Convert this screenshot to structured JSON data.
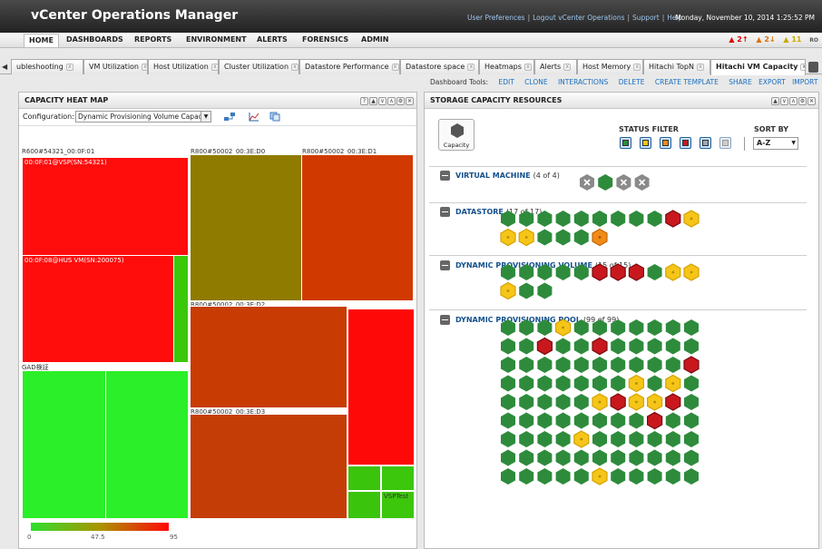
{
  "header": {
    "title": "vCenter Operations Manager",
    "links": [
      "User Preferences",
      "Logout vCenter Operations",
      "Support",
      "Help"
    ],
    "datetime": "Monday, November 10, 2014 1:25:52 PM"
  },
  "nav": {
    "items": [
      "HOME",
      "DASHBOARDS",
      "REPORTS",
      "ENVIRONMENT",
      "ALERTS",
      "FORENSICS",
      "ADMIN"
    ],
    "alerts": {
      "critical": "2",
      "immediate": "2",
      "warning": "11",
      "extra": "RO"
    }
  },
  "tabs": [
    "ubleshooting",
    "VM Utilization",
    "Host Utilization",
    "Cluster Utilization",
    "Datastore Performance",
    "Datastore space",
    "Heatmaps",
    "Alerts",
    "Host Memory",
    "Hitachi TopN",
    "Hitachi VM Capacity"
  ],
  "dashboard_tools": {
    "label": "Dashboard Tools:",
    "actions": [
      "EDIT",
      "CLONE",
      "INTERACTIONS",
      "DELETE",
      "CREATE TEMPLATE",
      "SHARE",
      "EXPORT",
      "IMPORT"
    ]
  },
  "heatmap_panel": {
    "title": "CAPACITY HEAT MAP",
    "config_label": "Configuration:",
    "config_value": "Dynamic Provisioning Volume Capaci",
    "groups": [
      "R600#54321_00:0F:01",
      "R800#50002_00:3E:D0",
      "R800#50002_00:3E:D1",
      "R800#50002_00:3E:D2",
      "R800#50002_00:3E:D3",
      "GAD検証",
      "VSPTest"
    ],
    "cell_labels": [
      "00:0F:01@VSP(SN:54321)",
      "00:0F:08@HUS VM(SN:200075)"
    ],
    "legend": {
      "min": "0",
      "mid": "47.5",
      "max": "95"
    }
  },
  "storage_panel": {
    "title": "STORAGE CAPACITY RESOURCES",
    "capacity_label": "Capacity",
    "status_filter_label": "STATUS FILTER",
    "sort_by_label": "SORT BY",
    "sort_value": "A-Z",
    "colors": {
      "green": "#2e8b3c",
      "red": "#c8181e",
      "yellow": "#f5c518",
      "orange": "#f08a18",
      "gray": "#8a8a8a"
    },
    "sections": [
      {
        "name": "VIRTUAL MACHINE",
        "count": "(4 of 4)",
        "hexes": [
          "x",
          "g",
          "x",
          "x"
        ]
      },
      {
        "name": "DATASTORE",
        "count": "(17 of 17)",
        "hexes": [
          "g",
          "g",
          "g",
          "g",
          "g",
          "g",
          "g",
          "g",
          "g",
          "r",
          "y",
          "y",
          "y",
          "g",
          "g",
          "g",
          "o"
        ]
      },
      {
        "name": "DYNAMIC PROVISIONING VOLUME",
        "count": "(15 of 15)",
        "hexes": [
          "g",
          "g",
          "g",
          "g",
          "g",
          "r",
          "r",
          "r",
          "g",
          "y",
          "y",
          "y",
          "g",
          "g"
        ]
      },
      {
        "name": "DYNAMIC PROVISIONING POOL",
        "count": "(99 of 99)",
        "hexes": [
          "g",
          "g",
          "g",
          "y",
          "g",
          "g",
          "g",
          "g",
          "g",
          "g",
          "g",
          "g",
          "g",
          "r",
          "g",
          "g",
          "r",
          "g",
          "g",
          "g",
          "g",
          "g",
          "g",
          "g",
          "g",
          "g",
          "g",
          "g",
          "g",
          "g",
          "g",
          "g",
          "r",
          "g",
          "g",
          "g",
          "g",
          "g",
          "g",
          "g",
          "y",
          "g",
          "y",
          "g",
          "g",
          "g",
          "g",
          "g",
          "g",
          "y",
          "r",
          "y",
          "y",
          "r",
          "g",
          "g",
          "g",
          "g",
          "g",
          "g",
          "g",
          "g",
          "g",
          "r",
          "g",
          "g",
          "g",
          "g",
          "g",
          "g",
          "y",
          "g",
          "g",
          "g",
          "g",
          "g",
          "g",
          "g",
          "g",
          "g",
          "g",
          "g",
          "g",
          "g",
          "g",
          "g",
          "g",
          "g",
          "g",
          "g",
          "g",
          "g",
          "g",
          "y",
          "g",
          "g",
          "g",
          "g",
          "g"
        ]
      }
    ]
  }
}
